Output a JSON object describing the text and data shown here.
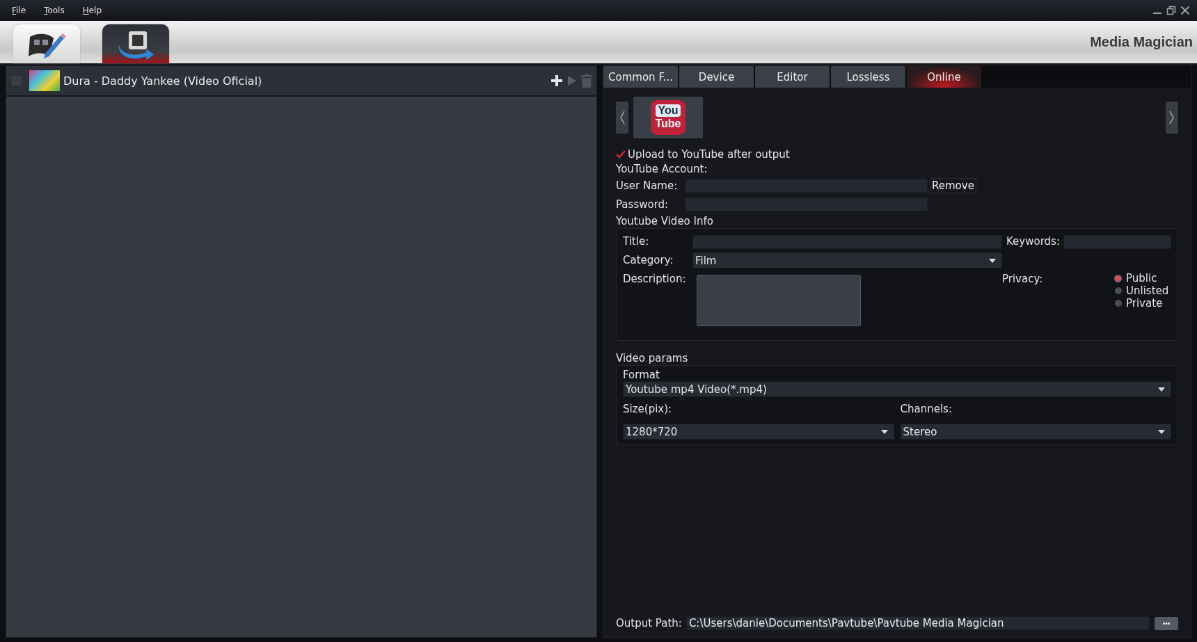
{
  "menu": [
    {
      "label": "File"
    },
    {
      "label": "Tools"
    },
    {
      "label": "Help"
    }
  ],
  "toolbar": {
    "modes": [
      {
        "kind": "edit",
        "selected": false
      },
      {
        "kind": "convert",
        "selected": true
      }
    ],
    "app_title": "Media Magician"
  },
  "file_list": {
    "items": [
      {
        "title": "Dura - Daddy Yankee (Video Oficial)",
        "checked": false
      }
    ]
  },
  "tabs": [
    {
      "label": "Common F...",
      "selected": false
    },
    {
      "label": "Device",
      "selected": false
    },
    {
      "label": "Editor",
      "selected": false
    },
    {
      "label": "Lossless",
      "selected": false
    },
    {
      "label": "Online",
      "selected": true
    }
  ],
  "online": {
    "service_logo": {
      "line_1": "You",
      "line_2": "Tube"
    },
    "upload_checkbox": {
      "label": "Upload to YouTube after output",
      "checked": true
    },
    "account_heading": "YouTube Account:",
    "user_name_label": "User Name:",
    "remove_button": "Remove",
    "password_label": "Password:",
    "video_info": {
      "heading": "Youtube Video Info",
      "title_label": "Title:",
      "keywords_label": "Keywords:",
      "category_label": "Category:",
      "category_value": "Film",
      "description_label": "Description:",
      "privacy_label": "Privacy:",
      "privacy_options": [
        {
          "label": "Public",
          "selected": true
        },
        {
          "label": "Unlisted",
          "selected": false
        },
        {
          "label": "Private",
          "selected": false
        }
      ]
    },
    "video_params": {
      "heading": "Video params",
      "format_label": "Format",
      "format_value": "Youtube mp4 Video(*.mp4)",
      "size_label": "Size(pix):",
      "size_value": "1280*720",
      "channels_label": "Channels:",
      "channels_value": "Stereo"
    },
    "output_path": {
      "label": "Output Path:",
      "value": "C:\\Users\\danie\\Documents\\Pavtube\\Pavtube Media Magician",
      "browse_button": "•••"
    }
  }
}
